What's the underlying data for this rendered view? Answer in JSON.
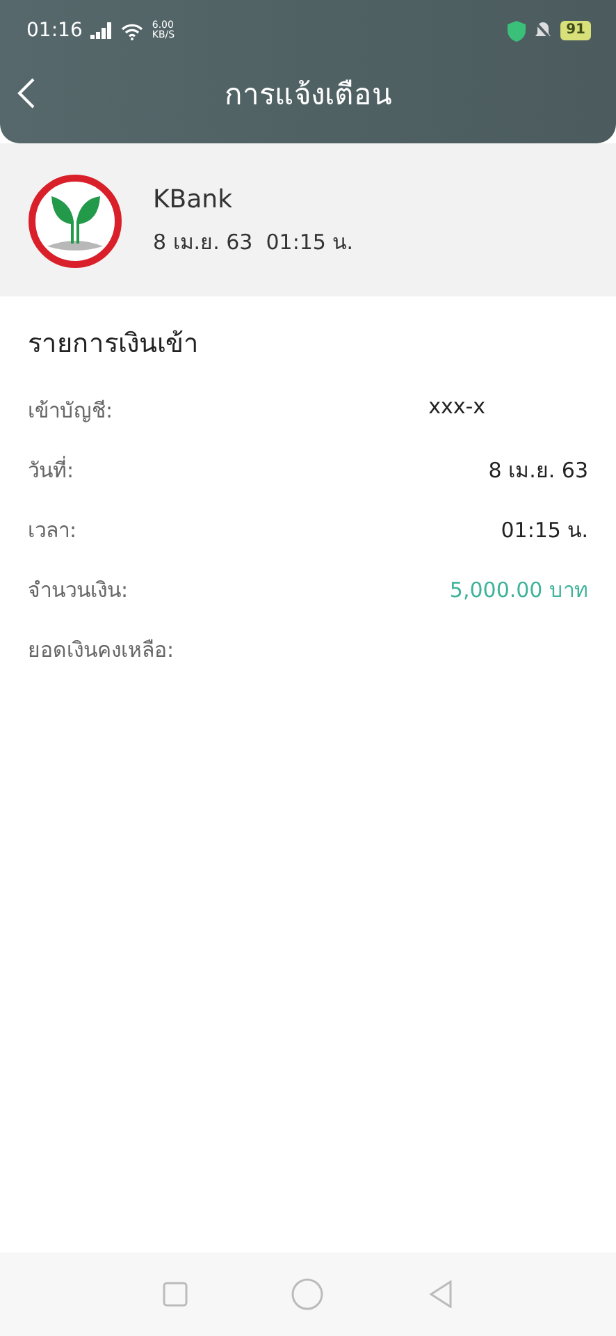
{
  "status_bar": {
    "time": "01:16",
    "speed_value": "6.00",
    "speed_unit": "KB/S",
    "battery": "91"
  },
  "header": {
    "title": "การแจ้งเตือน"
  },
  "sender": {
    "name": "KBank",
    "datetime": "8 เม.ย. 63  01:15 น."
  },
  "detail": {
    "title": "รายการเงินเข้า",
    "rows": [
      {
        "label": "เข้าบัญชี:",
        "value": "xxx-x",
        "kind": "masked"
      },
      {
        "label": "วันที่:",
        "value": "8 เม.ย. 63",
        "kind": "plain"
      },
      {
        "label": "เวลา:",
        "value": "01:15 น.",
        "kind": "plain"
      },
      {
        "label": "จำนวนเงิน:",
        "value": "5,000.00 บาท",
        "kind": "amount"
      },
      {
        "label": "ยอดเงินคงเหลือ:"
      }
    ]
  }
}
